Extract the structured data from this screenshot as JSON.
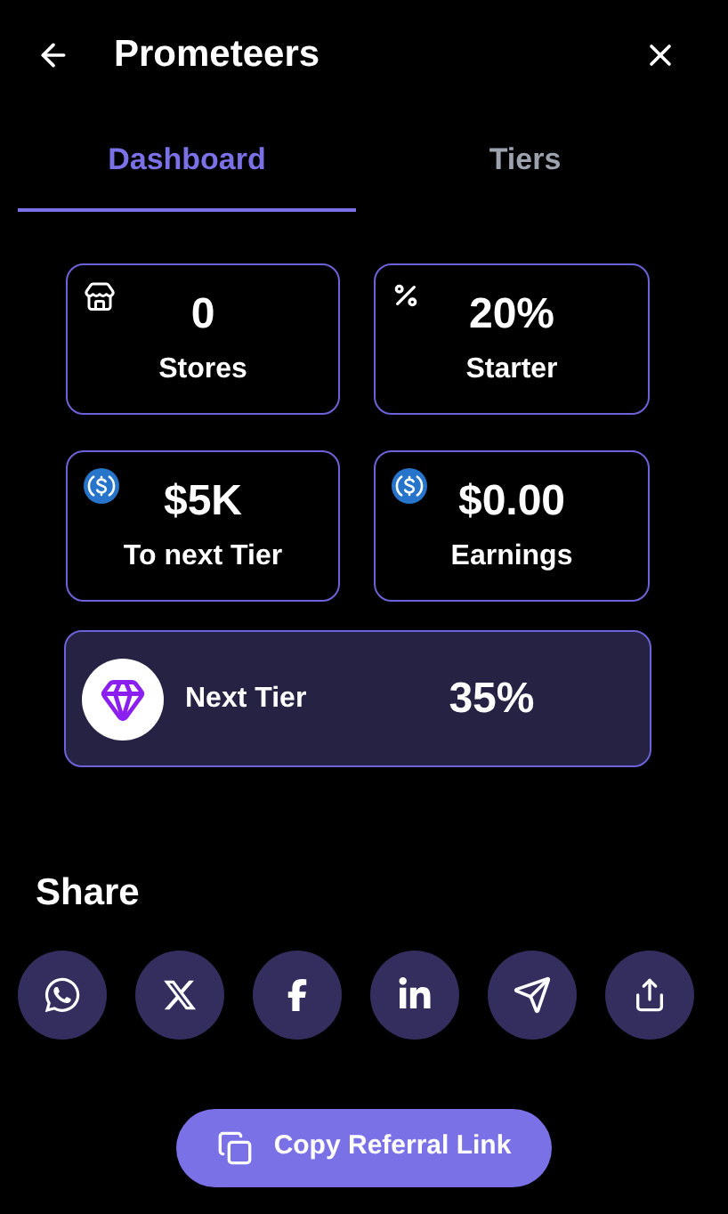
{
  "header": {
    "title": "Prometeers"
  },
  "tabs": [
    {
      "label": "Dashboard",
      "selected": true
    },
    {
      "label": "Tiers",
      "selected": false
    }
  ],
  "stats": [
    {
      "kind": "store",
      "value": "0",
      "label": "Stores"
    },
    {
      "kind": "percent",
      "value": "20%",
      "label": "Starter"
    },
    {
      "kind": "coin",
      "value": "$5K",
      "label": "To next Tier"
    },
    {
      "kind": "coin",
      "value": "$0.00",
      "label": "Earnings"
    }
  ],
  "next_tier": {
    "label": "Next Tier",
    "value": "35%"
  },
  "share": {
    "title": "Share",
    "buttons": [
      {
        "kind": "whatsapp"
      },
      {
        "kind": "x"
      },
      {
        "kind": "facebook"
      },
      {
        "kind": "linkedin"
      },
      {
        "kind": "telegram"
      },
      {
        "kind": "share"
      }
    ]
  },
  "copy_button": {
    "label": "Copy Referral Link"
  }
}
